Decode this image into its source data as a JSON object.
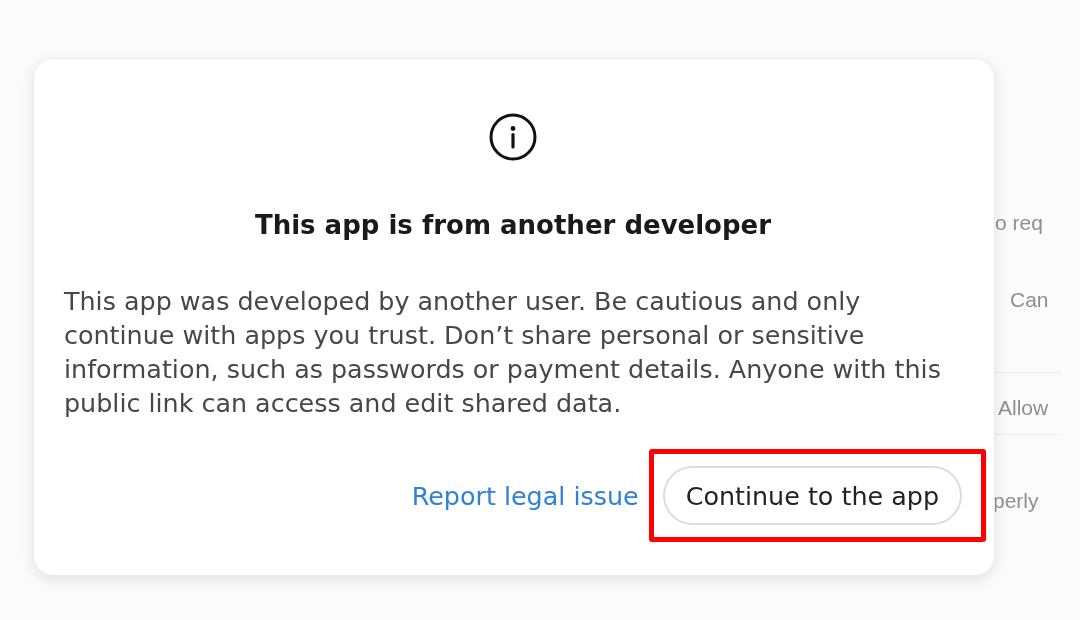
{
  "background": {
    "fragments": [
      {
        "text": "o req"
      },
      {
        "text": "Can"
      },
      {
        "text": "Allow"
      },
      {
        "text": "perly"
      }
    ]
  },
  "dialog": {
    "title": "This app is from another developer",
    "body": "This app was developed by another user. Be cautious and only continue with apps you trust. Don’t share personal or sensitive information, such as passwords or payment details. Anyone with this public link can access and edit shared data.",
    "actions": [
      {
        "kind": "link",
        "label": "Report legal issue",
        "highlighted": false
      },
      {
        "kind": "button",
        "label": "Continue to the app",
        "highlighted": true
      }
    ]
  }
}
